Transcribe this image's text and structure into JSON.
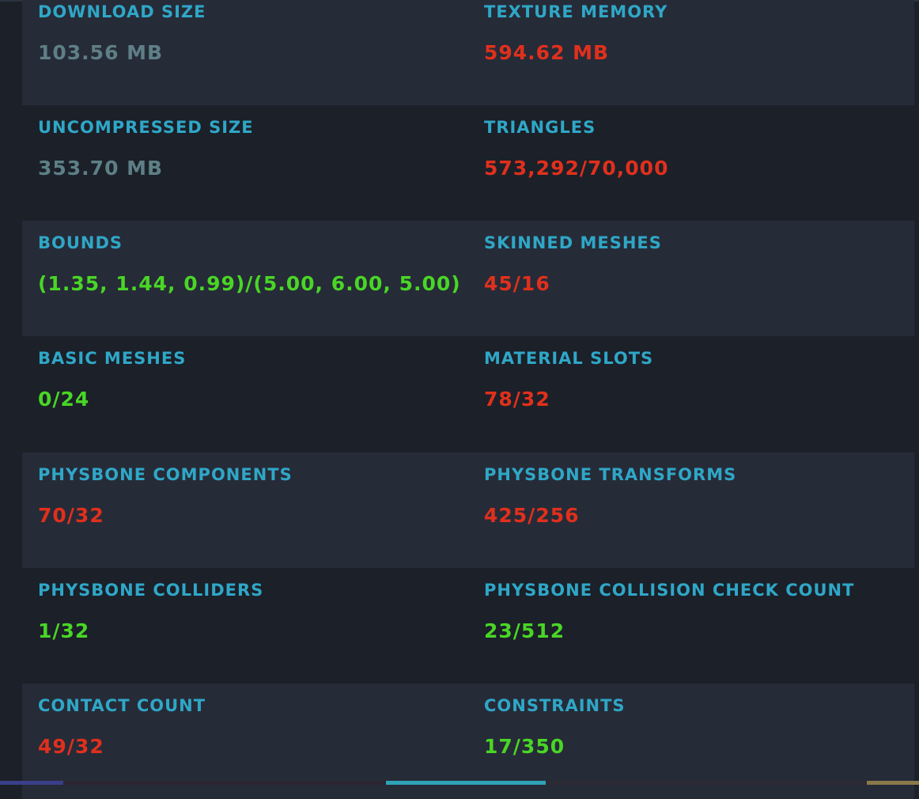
{
  "stats": [
    {
      "label": "DOWNLOAD SIZE",
      "value": "103.56 MB",
      "status": "neutral"
    },
    {
      "label": "TEXTURE MEMORY",
      "value": "594.62 MB",
      "status": "bad"
    },
    {
      "label": "UNCOMPRESSED SIZE",
      "value": "353.70 MB",
      "status": "neutral"
    },
    {
      "label": "TRIANGLES",
      "value": "573,292/70,000",
      "status": "bad"
    },
    {
      "label": "BOUNDS",
      "value": "(1.35, 1.44, 0.99)/(5.00, 6.00, 5.00)",
      "status": "good"
    },
    {
      "label": "SKINNED MESHES",
      "value": "45/16",
      "status": "bad"
    },
    {
      "label": "BASIC MESHES",
      "value": "0/24",
      "status": "good"
    },
    {
      "label": "MATERIAL SLOTS",
      "value": "78/32",
      "status": "bad"
    },
    {
      "label": "PHYSBONE COMPONENTS",
      "value": "70/32",
      "status": "bad"
    },
    {
      "label": "PHYSBONE TRANSFORMS",
      "value": "425/256",
      "status": "bad"
    },
    {
      "label": "PHYSBONE COLLIDERS",
      "value": "1/32",
      "status": "good"
    },
    {
      "label": "PHYSBONE COLLISION CHECK COUNT",
      "value": "23/512",
      "status": "good"
    },
    {
      "label": "CONTACT COUNT",
      "value": "49/32",
      "status": "bad"
    },
    {
      "label": "CONSTRAINTS",
      "value": "17/350",
      "status": "good"
    }
  ],
  "colors": {
    "label": "#2fa7c7",
    "neutral": "#5e7f86",
    "bad": "#e0301c",
    "good": "#49d625",
    "row_shade": "#262b38",
    "row_plain": "#1b2029"
  }
}
